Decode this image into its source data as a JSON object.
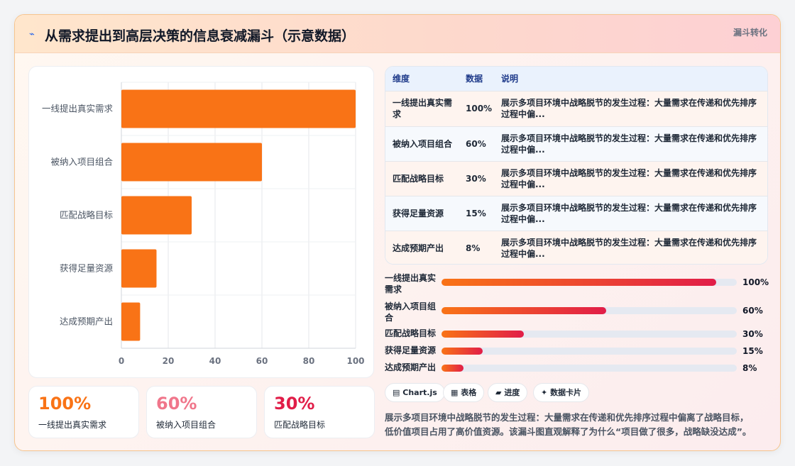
{
  "header": {
    "icon": "⌁",
    "title": "从需求提出到高层决策的信息衰减漏斗（示意数据）",
    "badge": "漏斗转化"
  },
  "chart_data": {
    "type": "bar",
    "orientation": "horizontal",
    "categories": [
      "一线提出真实需求",
      "被纳入项目组合",
      "匹配战略目标",
      "获得足量资源",
      "达成预期产出"
    ],
    "values": [
      100,
      60,
      30,
      15,
      8
    ],
    "xlim": [
      0,
      100
    ],
    "xticks": [
      0,
      20,
      40,
      60,
      80,
      100
    ],
    "grid": true,
    "bar_color": "#f97316"
  },
  "stats": [
    {
      "value": "100%",
      "label": "一线提出真实需求",
      "color": "#f97316"
    },
    {
      "value": "60%",
      "label": "被纳入项目组合",
      "color": "#f0768b"
    },
    {
      "value": "30%",
      "label": "匹配战略目标",
      "color": "#e11d48"
    }
  ],
  "table": {
    "headers": [
      "维度",
      "数据",
      "说明"
    ],
    "rows": [
      {
        "dim1": "一线提出真实需",
        "dim2": "求",
        "val": "100%",
        "desc1": "展示多项目环境中战略脱节的发生过程：大量需求在传递和优先排序",
        "desc2": "过程中偏..."
      },
      {
        "dim1": "被纳入项目组合",
        "dim2": "",
        "val": "60%",
        "desc1": "展示多项目环境中战略脱节的发生过程：大量需求在传递和优先排序",
        "desc2": "过程中偏..."
      },
      {
        "dim1": "匹配战略目标",
        "dim2": "",
        "val": "30%",
        "desc1": "展示多项目环境中战略脱节的发生过程：大量需求在传递和优先排序",
        "desc2": "过程中偏..."
      },
      {
        "dim1": "获得足量资源",
        "dim2": "",
        "val": "15%",
        "desc1": "展示多项目环境中战略脱节的发生过程：大量需求在传递和优先排序",
        "desc2": "过程中偏..."
      },
      {
        "dim1": "达成预期产出",
        "dim2": "",
        "val": "8%",
        "desc1": "展示多项目环境中战略脱节的发生过程：大量需求在传递和优先排序",
        "desc2": "过程中偏..."
      }
    ]
  },
  "progress": [
    {
      "label1": "一线提出真实",
      "label2": "需求",
      "value": 100,
      "text": "100%"
    },
    {
      "label1": "被纳入项目组",
      "label2": "合",
      "value": 60,
      "text": "60%"
    },
    {
      "label1": "匹配战略目标",
      "label2": "",
      "value": 30,
      "text": "30%"
    },
    {
      "label1": "获得足量资源",
      "label2": "",
      "value": 15,
      "text": "15%"
    },
    {
      "label1": "达成预期产出",
      "label2": "",
      "value": 8,
      "text": "8%"
    }
  ],
  "chips": [
    {
      "icon": "▤",
      "label": "Chart.js"
    },
    {
      "icon": "▦",
      "label": "表格"
    },
    {
      "icon": "▰",
      "label": "进度"
    },
    {
      "icon": "✦",
      "label": "数据卡片"
    }
  ],
  "description": {
    "line1": "展示多项目环境中战略脱节的发生过程：大量需求在传递和优先排序过程中偏离了战略目标，",
    "line2": "低价值项目占用了高价值资源。该漏斗图直观解释了为什么“项目做了很多，战略缺没达成”。"
  }
}
